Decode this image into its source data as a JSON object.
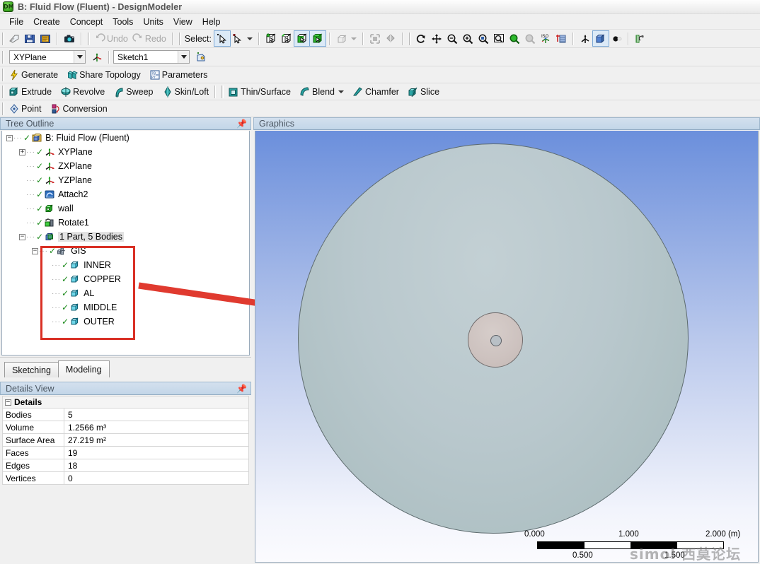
{
  "window": {
    "title": "B: Fluid Flow (Fluent) - DesignModeler",
    "logo_text": "DM"
  },
  "menu": {
    "items": [
      "File",
      "Create",
      "Concept",
      "Tools",
      "Units",
      "View",
      "Help"
    ]
  },
  "toolbar_main": {
    "icons": [
      "new-icon",
      "save-icon",
      "save-as-icon",
      "camera-icon"
    ],
    "undo_label": "Undo",
    "redo_label": "Redo",
    "select_label": "Select:",
    "select_modes": [
      "single-select-icon",
      "box-select-icon"
    ],
    "filter_icons": [
      "select-vertex-icon",
      "select-edge-icon",
      "select-face-icon",
      "select-body-icon"
    ],
    "extend_icon": "extend-selection-icon",
    "view_icons": [
      "show-whole-icon",
      "show-section-icon"
    ],
    "nav_icons": [
      "rotate-icon",
      "pan-icon",
      "zoom-icon",
      "zoom-in-icon",
      "box-zoom-icon",
      "zoom-to-fit-icon",
      "magnify-icon",
      "previous-view-icon",
      "iso-view-icon",
      "look-at-icon"
    ],
    "display_icons": [
      "axis-icon",
      "solid-shaded-icon",
      "wireframe-icon",
      "ruler-icon"
    ]
  },
  "toolbar_plane": {
    "plane_value": "XYPlane",
    "new_plane_icon": "new-plane-icon",
    "sketch_value": "Sketch1",
    "new_sketch_icon": "new-sketch-icon"
  },
  "toolbar_generate": {
    "buttons": [
      {
        "label": "Generate",
        "icon": "lightning-icon"
      },
      {
        "label": "Share Topology",
        "icon": "share-topology-icon"
      },
      {
        "label": "Parameters",
        "icon": "parameters-icon"
      }
    ]
  },
  "toolbar_features": {
    "group1": [
      {
        "label": "Extrude",
        "icon": "extrude-icon"
      },
      {
        "label": "Revolve",
        "icon": "revolve-icon"
      },
      {
        "label": "Sweep",
        "icon": "sweep-icon"
      },
      {
        "label": "Skin/Loft",
        "icon": "skin-loft-icon"
      }
    ],
    "group2": [
      {
        "label": "Thin/Surface",
        "icon": "thin-surface-icon"
      },
      {
        "label": "Blend",
        "icon": "blend-icon",
        "dropdown": true
      },
      {
        "label": "Chamfer",
        "icon": "chamfer-icon"
      },
      {
        "label": "Slice",
        "icon": "slice-icon"
      }
    ]
  },
  "toolbar_point": {
    "buttons": [
      {
        "label": "Point",
        "icon": "point-icon"
      },
      {
        "label": "Conversion",
        "icon": "conversion-icon"
      }
    ]
  },
  "tree": {
    "title": "Tree Outline",
    "pin_icon": "pin-icon",
    "nodes": [
      {
        "label": "B: Fluid Flow (Fluent)",
        "depth": 0,
        "expander": "-",
        "icon": "project-icon",
        "check": true
      },
      {
        "label": "XYPlane",
        "depth": 1,
        "expander": "+",
        "icon": "plane-icon",
        "check": true
      },
      {
        "label": "ZXPlane",
        "depth": 1,
        "expander": "",
        "icon": "plane-icon",
        "check": true
      },
      {
        "label": "YZPlane",
        "depth": 1,
        "expander": "",
        "icon": "plane-icon",
        "check": true
      },
      {
        "label": "Attach2",
        "depth": 1,
        "expander": "",
        "icon": "attach-icon",
        "check": true
      },
      {
        "label": "wall",
        "depth": 1,
        "expander": "",
        "icon": "body-green-icon",
        "check": true
      },
      {
        "label": "Rotate1",
        "depth": 1,
        "expander": "",
        "icon": "rotate-feature-icon",
        "check": true
      },
      {
        "label": "1 Part, 5 Bodies",
        "depth": 1,
        "expander": "-",
        "icon": "part-icon",
        "check": true,
        "selected": true
      },
      {
        "label": "GIS",
        "depth": 2,
        "expander": "-",
        "icon": "part-multi-icon",
        "check": true
      },
      {
        "label": "INNER",
        "depth": 3,
        "expander": "",
        "icon": "solid-body-icon",
        "check": true
      },
      {
        "label": "COPPER",
        "depth": 3,
        "expander": "",
        "icon": "solid-body-icon",
        "check": true
      },
      {
        "label": "AL",
        "depth": 3,
        "expander": "",
        "icon": "solid-body-icon",
        "check": true
      },
      {
        "label": "MIDDLE",
        "depth": 3,
        "expander": "",
        "icon": "solid-body-icon",
        "check": true
      },
      {
        "label": "OUTER",
        "depth": 3,
        "expander": "",
        "icon": "solid-body-icon",
        "check": true
      }
    ]
  },
  "annotation": {
    "box_color": "#d93025",
    "arrow_color": "#e03a2f"
  },
  "tabs": {
    "items": [
      {
        "label": "Sketching",
        "active": false
      },
      {
        "label": "Modeling",
        "active": true
      }
    ]
  },
  "details": {
    "title": "Details View",
    "pin_icon": "pin-icon",
    "group_label": "Details",
    "rows": [
      {
        "key": "Bodies",
        "value": "5"
      },
      {
        "key": "Volume",
        "value": "1.2566 m³"
      },
      {
        "key": "Surface Area",
        "value": "27.219 m²"
      },
      {
        "key": "Faces",
        "value": "19"
      },
      {
        "key": "Edges",
        "value": "18"
      },
      {
        "key": "Vertices",
        "value": "0"
      }
    ]
  },
  "graphics": {
    "title": "Graphics",
    "background_top": "#6b8fdc",
    "background_bottom": "#fbfbfe",
    "disc_color": "#b4c4c8",
    "hub_color": "#cdc2bf",
    "scale_bar": {
      "top_labels": [
        "0.000",
        "1.000",
        "2.000 (m)"
      ],
      "bottom_labels": [
        "0.500",
        "1.500"
      ],
      "segments": [
        "on",
        "off",
        "on",
        "off"
      ]
    },
    "watermark": "simol 西莫论坛"
  }
}
